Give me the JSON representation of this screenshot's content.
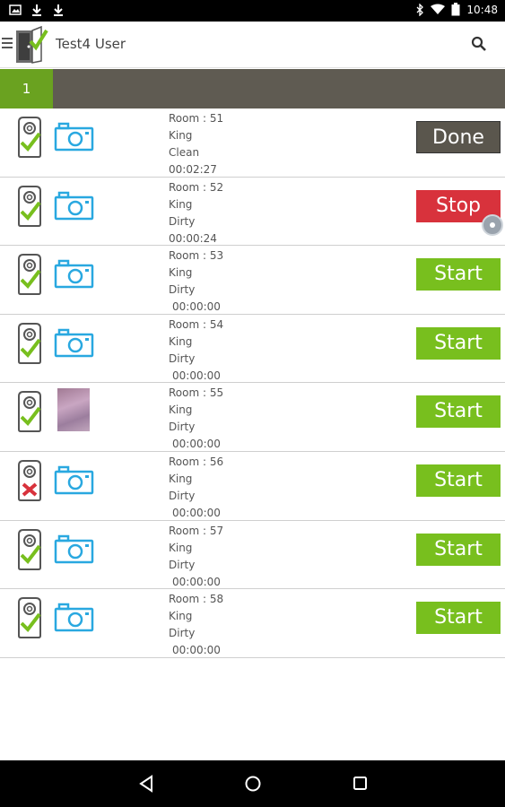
{
  "status_bar": {
    "time": "10:48"
  },
  "app_bar": {
    "title": "Test4 User"
  },
  "tabs": [
    {
      "label": "1"
    }
  ],
  "colors": {
    "accent_green": "#78bf1e",
    "tab_green": "#6aa220",
    "stop_red": "#d8323c",
    "done_gray": "#5a564d",
    "camera_blue": "#29a8e0"
  },
  "rooms": [
    {
      "room": "Room : 51",
      "bed": "King",
      "status": "Clean",
      "timer": "00:02:27",
      "action": "Done",
      "action_style": "done",
      "tag": "check",
      "media": "camera"
    },
    {
      "room": "Room : 52",
      "bed": "King",
      "status": "Dirty",
      "timer": "00:00:24",
      "action": "Stop",
      "action_style": "stop",
      "tag": "check",
      "media": "camera"
    },
    {
      "room": "Room : 53",
      "bed": "King",
      "status": "Dirty",
      "timer": "00:00:00",
      "action": "Start",
      "action_style": "start",
      "tag": "check",
      "media": "camera"
    },
    {
      "room": "Room : 54",
      "bed": "King",
      "status": "Dirty",
      "timer": "00:00:00",
      "action": "Start",
      "action_style": "start",
      "tag": "check",
      "media": "camera"
    },
    {
      "room": "Room : 55",
      "bed": "King",
      "status": "Dirty",
      "timer": "00:00:00",
      "action": "Start",
      "action_style": "start",
      "tag": "check",
      "media": "photo"
    },
    {
      "room": "Room : 56",
      "bed": "King",
      "status": "Dirty",
      "timer": "00:00:00",
      "action": "Start",
      "action_style": "start",
      "tag": "cross",
      "media": "camera"
    },
    {
      "room": "Room : 57",
      "bed": "King",
      "status": "Dirty",
      "timer": "00:00:00",
      "action": "Start",
      "action_style": "start",
      "tag": "check",
      "media": "camera"
    },
    {
      "room": "Room : 58",
      "bed": "King",
      "status": "Dirty",
      "timer": "00:00:00",
      "action": "Start",
      "action_style": "start",
      "tag": "check",
      "media": "camera"
    }
  ]
}
